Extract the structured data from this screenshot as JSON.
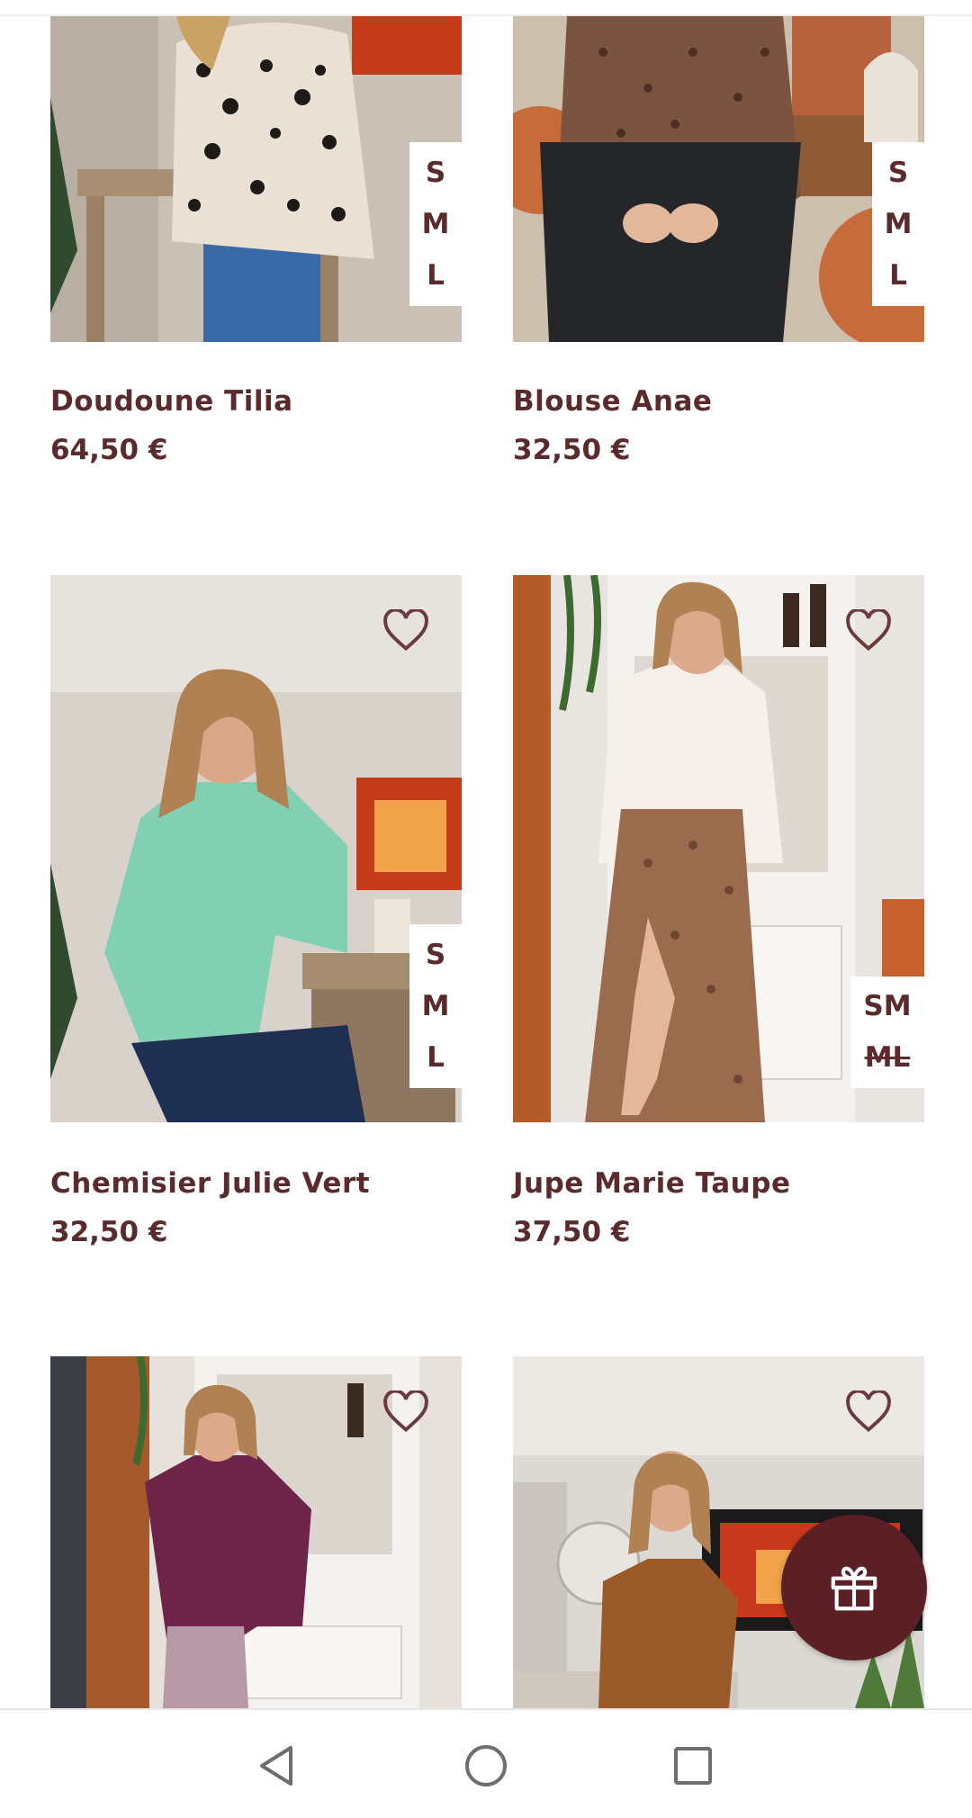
{
  "products": [
    {
      "name": "Doudoune Tilia",
      "price": "64,50 €",
      "sizes": [
        {
          "label": "S",
          "available": true
        },
        {
          "label": "M",
          "available": true
        },
        {
          "label": "L",
          "available": true
        }
      ],
      "image": "leopard-print-jacket-photo"
    },
    {
      "name": "Blouse Anae",
      "price": "32,50 €",
      "sizes": [
        {
          "label": "S",
          "available": true
        },
        {
          "label": "M",
          "available": true
        },
        {
          "label": "L",
          "available": true
        }
      ],
      "image": "snake-print-blouse-photo"
    },
    {
      "name": "Chemisier Julie Vert",
      "price": "32,50 €",
      "sizes": [
        {
          "label": "S",
          "available": true
        },
        {
          "label": "M",
          "available": true
        },
        {
          "label": "L",
          "available": true
        }
      ],
      "image": "green-shirt-photo"
    },
    {
      "name": "Jupe Marie Taupe",
      "price": "37,50 €",
      "sizes": [
        {
          "label": "SM",
          "available": true
        },
        {
          "label": "ML",
          "available": false
        }
      ],
      "image": "floral-skirt-photo"
    },
    {
      "image": "burgundy-blouse-photo"
    },
    {
      "image": "camel-suede-jacket-photo"
    }
  ],
  "icons": {
    "favorite": "heart-outline-icon",
    "gift": "gift-icon",
    "nav_back": "triangle-back-icon",
    "nav_home": "circle-home-icon",
    "nav_recents": "square-recents-icon"
  },
  "colors": {
    "brand": "#5b2026",
    "text": "#5a2a2c",
    "icon_outline": "#6b3a3c"
  }
}
